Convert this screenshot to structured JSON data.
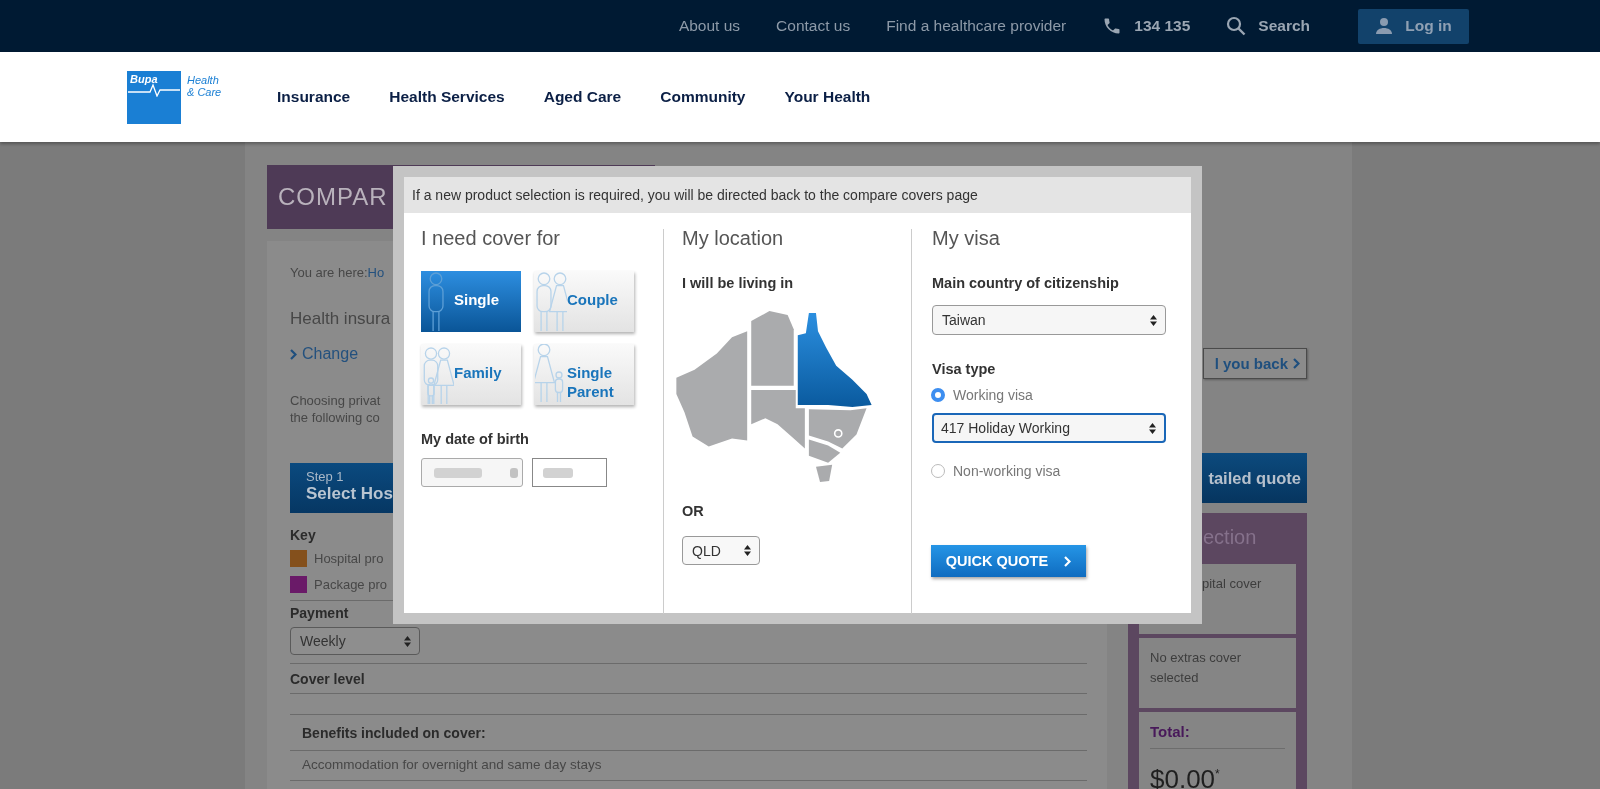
{
  "top_bar": {
    "links": [
      "About us",
      "Contact us",
      "Find a healthcare provider"
    ],
    "phone": "134 135",
    "search": "Search",
    "login": "Log in"
  },
  "logo": {
    "brand": "Bupa",
    "tagline": [
      "Health",
      "& Care"
    ]
  },
  "nav": [
    "Insurance",
    "Health Services",
    "Aged Care",
    "Community",
    "Your Health"
  ],
  "page": {
    "title": "COMPAR",
    "breadcrumb_label": "You are here:",
    "breadcrumb_link": "Ho",
    "heading": "Health insura",
    "change_link": "Change",
    "intro_lines": [
      "Choosing privat",
      "the following co"
    ],
    "step": {
      "label": "Step 1",
      "title": "Select Hos"
    },
    "key": {
      "title": "Key",
      "items": [
        {
          "label": "Hospital pro",
          "color": "#84501c"
        },
        {
          "label": "Package pro",
          "color": "#6a1a68"
        }
      ]
    },
    "payment": {
      "label": "Payment",
      "value": "Weekly"
    },
    "cover_level": "Cover level",
    "benefits_heading": "Benefits included on cover:",
    "benefits": [
      "Accommodation for overnight and same day stays"
    ]
  },
  "sidebar": {
    "call_back": "l you back",
    "quote_bar": "tailed quote",
    "selection_title": "ection",
    "hospital_text": "pital cover",
    "extras_text": "No extras cover selected",
    "total_label": "Total:",
    "total": "$0.00$^{*}$"
  },
  "modal": {
    "notice": "If a new product selection is required, you will be directed back to the compare covers page",
    "cover": {
      "title": "I need cover for",
      "options": [
        {
          "label": "Single",
          "kind": "single",
          "selected": true
        },
        {
          "label": "Couple",
          "kind": "couple",
          "selected": false
        },
        {
          "label": "Family",
          "kind": "family",
          "selected": false
        },
        {
          "label": "Single Parent",
          "kind": "single_parent",
          "selected": false
        }
      ],
      "dob_label": "My date of birth"
    },
    "location": {
      "title": "My location",
      "prompt": "I will be living in",
      "or": "OR",
      "state": "QLD"
    },
    "visa": {
      "title": "My visa",
      "citizenship_label": "Main country of citizenship",
      "citizenship": "Taiwan",
      "visa_type_label": "Visa type",
      "options": [
        {
          "label": "Working visa",
          "selected": true
        },
        {
          "label": "Non-working visa",
          "selected": false
        }
      ],
      "visa": "417 Holiday Working",
      "submit": "QUICK QUOTE"
    }
  }
}
